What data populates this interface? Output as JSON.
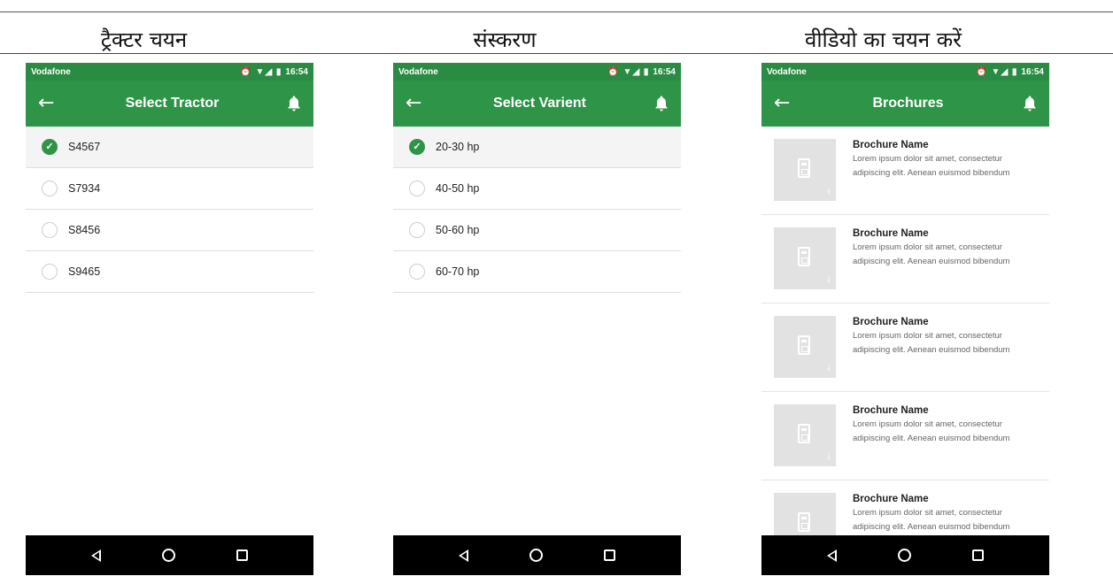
{
  "columns": [
    {
      "heading": "ट्रैक्टर चयन"
    },
    {
      "heading": "संस्करण"
    },
    {
      "heading": "वीडियो का चयन करें"
    }
  ],
  "status_bar": {
    "carrier": "Vodafone",
    "time": "16:54",
    "icons": "⏰ ▼◢ ▮"
  },
  "screens": {
    "tractor": {
      "title": "Select Tractor",
      "items": [
        {
          "label": "S4567",
          "selected": true
        },
        {
          "label": "S7934",
          "selected": false
        },
        {
          "label": "S8456",
          "selected": false
        },
        {
          "label": "S9465",
          "selected": false
        }
      ]
    },
    "variant": {
      "title": "Select Varient",
      "items": [
        {
          "label": "20-30 hp",
          "selected": true
        },
        {
          "label": "40-50 hp",
          "selected": false
        },
        {
          "label": "50-60 hp",
          "selected": false
        },
        {
          "label": "60-70 hp",
          "selected": false
        }
      ]
    },
    "brochures": {
      "title": "Brochures",
      "items": [
        {
          "name": "Brochure Name",
          "desc": "Lorem ipsum dolor sit amet, consectetur adipiscing elit. Aenean euismod bibendum"
        },
        {
          "name": "Brochure Name",
          "desc": "Lorem ipsum dolor sit amet, consectetur adipiscing elit. Aenean euismod bibendum"
        },
        {
          "name": "Brochure Name",
          "desc": "Lorem ipsum dolor sit amet, consectetur adipiscing elit. Aenean euismod bibendum"
        },
        {
          "name": "Brochure Name",
          "desc": "Lorem ipsum dolor sit amet, consectetur adipiscing elit. Aenean euismod bibendum"
        },
        {
          "name": "Brochure Name",
          "desc": "Lorem ipsum dolor sit amet, consectetur adipiscing elit. Aenean euismod bibendum"
        }
      ]
    }
  },
  "colors": {
    "status_bar": "#2a8b42",
    "app_bar": "#2e9448",
    "accent": "#2e9448",
    "nav_bar": "#000000"
  }
}
